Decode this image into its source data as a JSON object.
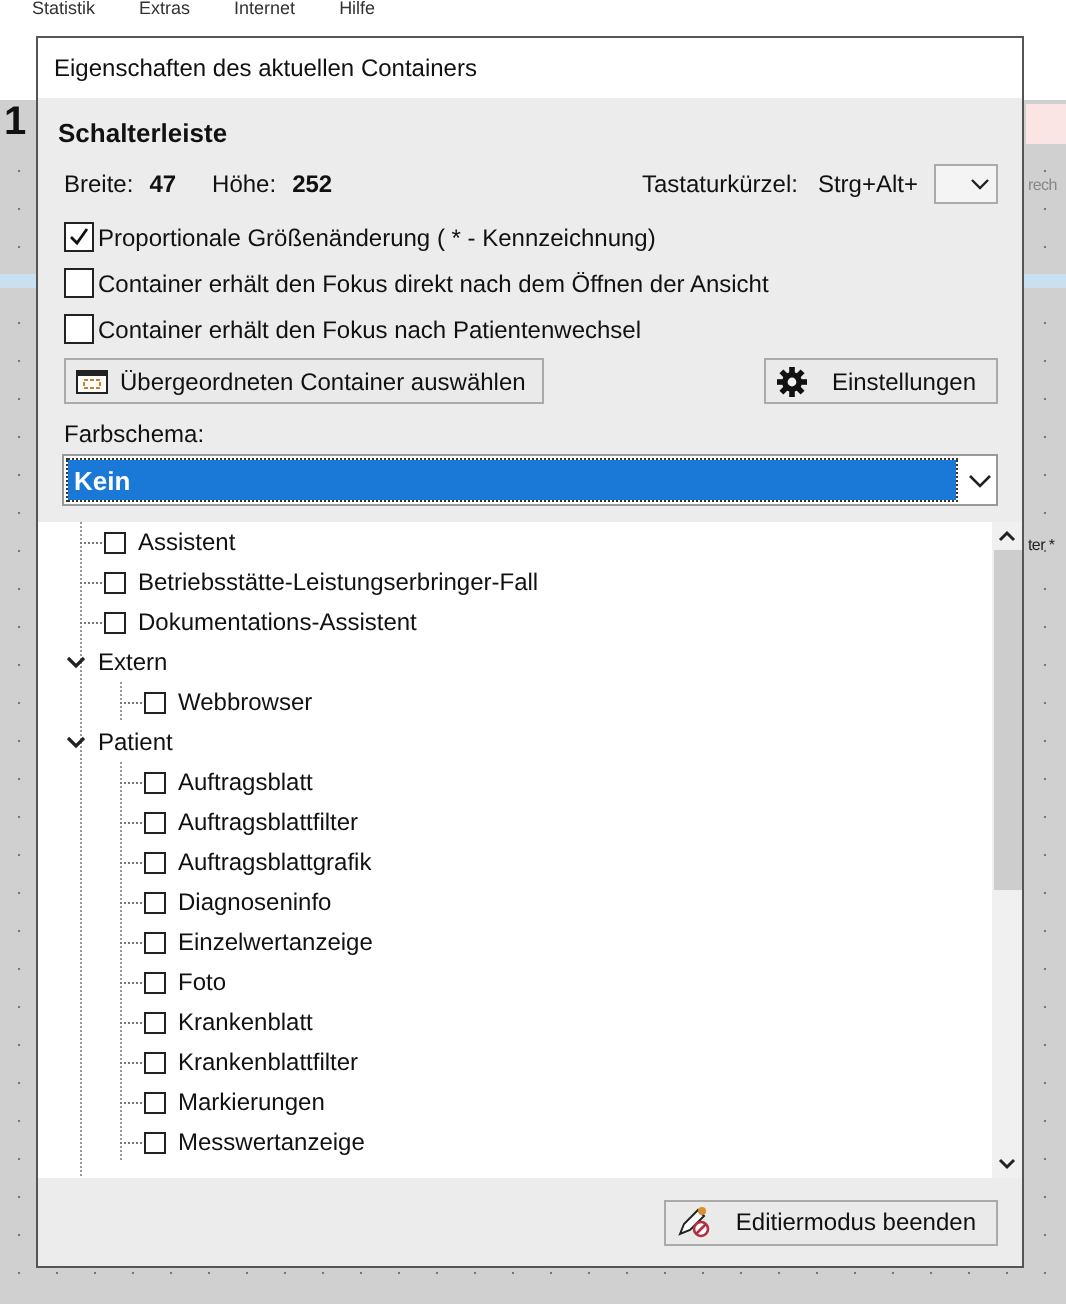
{
  "background": {
    "menu": [
      "Statistik",
      "Extras",
      "Internet",
      "Hilfe"
    ],
    "heading": "1",
    "side_texts": [
      "rech",
      "ter *"
    ]
  },
  "dialog": {
    "title": "Eigenschaften des aktuellen Containers",
    "section": "Schalterleiste",
    "width_label": "Breite:",
    "width_value": "47",
    "height_label": "Höhe:",
    "height_value": "252",
    "shortcut_label": "Tastaturkürzel:",
    "shortcut_prefix": "Strg+Alt+",
    "options": [
      {
        "label": "Proportionale Größenänderung ( * - Kennzeichnung)",
        "checked": true
      },
      {
        "label": "Container erhält den Fokus direkt nach dem Öffnen der Ansicht",
        "checked": false
      },
      {
        "label": "Container erhält den Fokus nach Patientenwechsel",
        "checked": false
      }
    ],
    "parent_button": "Übergeordneten Container auswählen",
    "settings_button": "Einstellungen",
    "color_scheme_label": "Farbschema:",
    "color_scheme_value": "Kein",
    "tree": [
      {
        "kind": "leaf",
        "label": "Assistent",
        "checked": false
      },
      {
        "kind": "leaf",
        "label": "Betriebsstätte-Leistungserbringer-Fall",
        "checked": false
      },
      {
        "kind": "leaf",
        "label": "Dokumentations-Assistent",
        "checked": false
      },
      {
        "kind": "group",
        "label": "Extern",
        "expanded": true,
        "children": [
          {
            "kind": "leaf",
            "label": "Webbrowser",
            "checked": false
          }
        ]
      },
      {
        "kind": "group",
        "label": "Patient",
        "expanded": true,
        "children": [
          {
            "kind": "leaf",
            "label": "Auftragsblatt",
            "checked": false
          },
          {
            "kind": "leaf",
            "label": "Auftragsblattfilter",
            "checked": false
          },
          {
            "kind": "leaf",
            "label": "Auftragsblattgrafik",
            "checked": false
          },
          {
            "kind": "leaf",
            "label": "Diagnoseninfo",
            "checked": false
          },
          {
            "kind": "leaf",
            "label": "Einzelwertanzeige",
            "checked": false
          },
          {
            "kind": "leaf",
            "label": "Foto",
            "checked": false
          },
          {
            "kind": "leaf",
            "label": "Krankenblatt",
            "checked": false
          },
          {
            "kind": "leaf",
            "label": "Krankenblattfilter",
            "checked": false
          },
          {
            "kind": "leaf",
            "label": "Markierungen",
            "checked": false
          },
          {
            "kind": "leaf",
            "label": "Messwertanzeige",
            "checked": false
          }
        ]
      }
    ],
    "finish_button": "Editiermodus beenden"
  }
}
